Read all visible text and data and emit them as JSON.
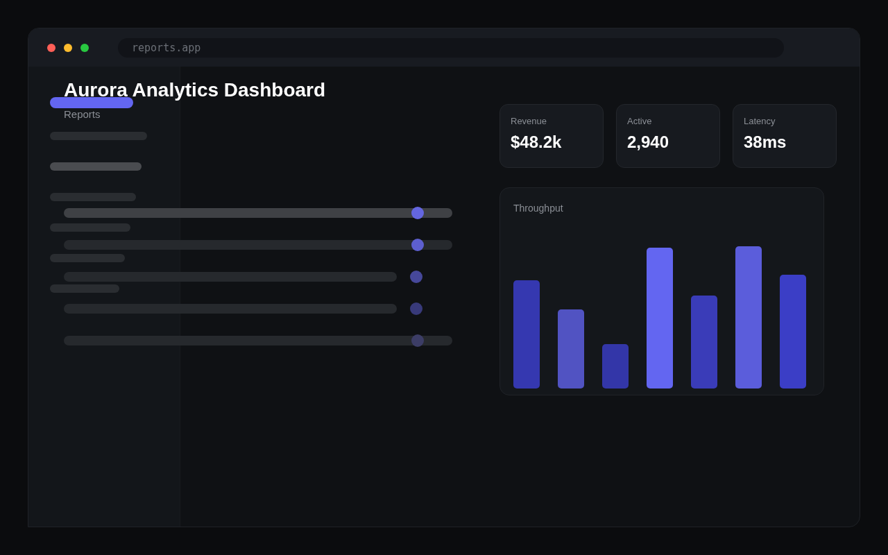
{
  "window": {
    "url": "reports.app"
  },
  "sidebar": {
    "items": [
      {
        "selected": true,
        "highlighted": false
      },
      {
        "selected": false,
        "highlighted": false
      },
      {
        "selected": false,
        "highlighted": true
      },
      {
        "selected": false,
        "highlighted": false
      },
      {
        "selected": false,
        "highlighted": false
      },
      {
        "selected": false,
        "highlighted": false
      },
      {
        "selected": false,
        "highlighted": false
      }
    ]
  },
  "header": {
    "title": "Aurora Analytics Dashboard",
    "subtitle": "Reports"
  },
  "controls": [
    {
      "kind": "slider",
      "selected": true,
      "level": 0.91,
      "color": "#6466e0"
    },
    {
      "kind": "slider",
      "selected": false,
      "level": 0.91,
      "color": "#5d5fcf"
    },
    {
      "kind": "status",
      "selected": false,
      "color": "#46489a"
    },
    {
      "kind": "status",
      "selected": false,
      "color": "#383a7a"
    },
    {
      "kind": "slider",
      "selected": false,
      "level": 0.91,
      "color": "#3c3d66"
    }
  ],
  "stats": [
    {
      "label": "Revenue",
      "value": "$48.2k"
    },
    {
      "label": "Active",
      "value": "2,940"
    },
    {
      "label": "Latency",
      "value": "38ms"
    }
  ],
  "throughput": {
    "title": "Throughput"
  }
}
